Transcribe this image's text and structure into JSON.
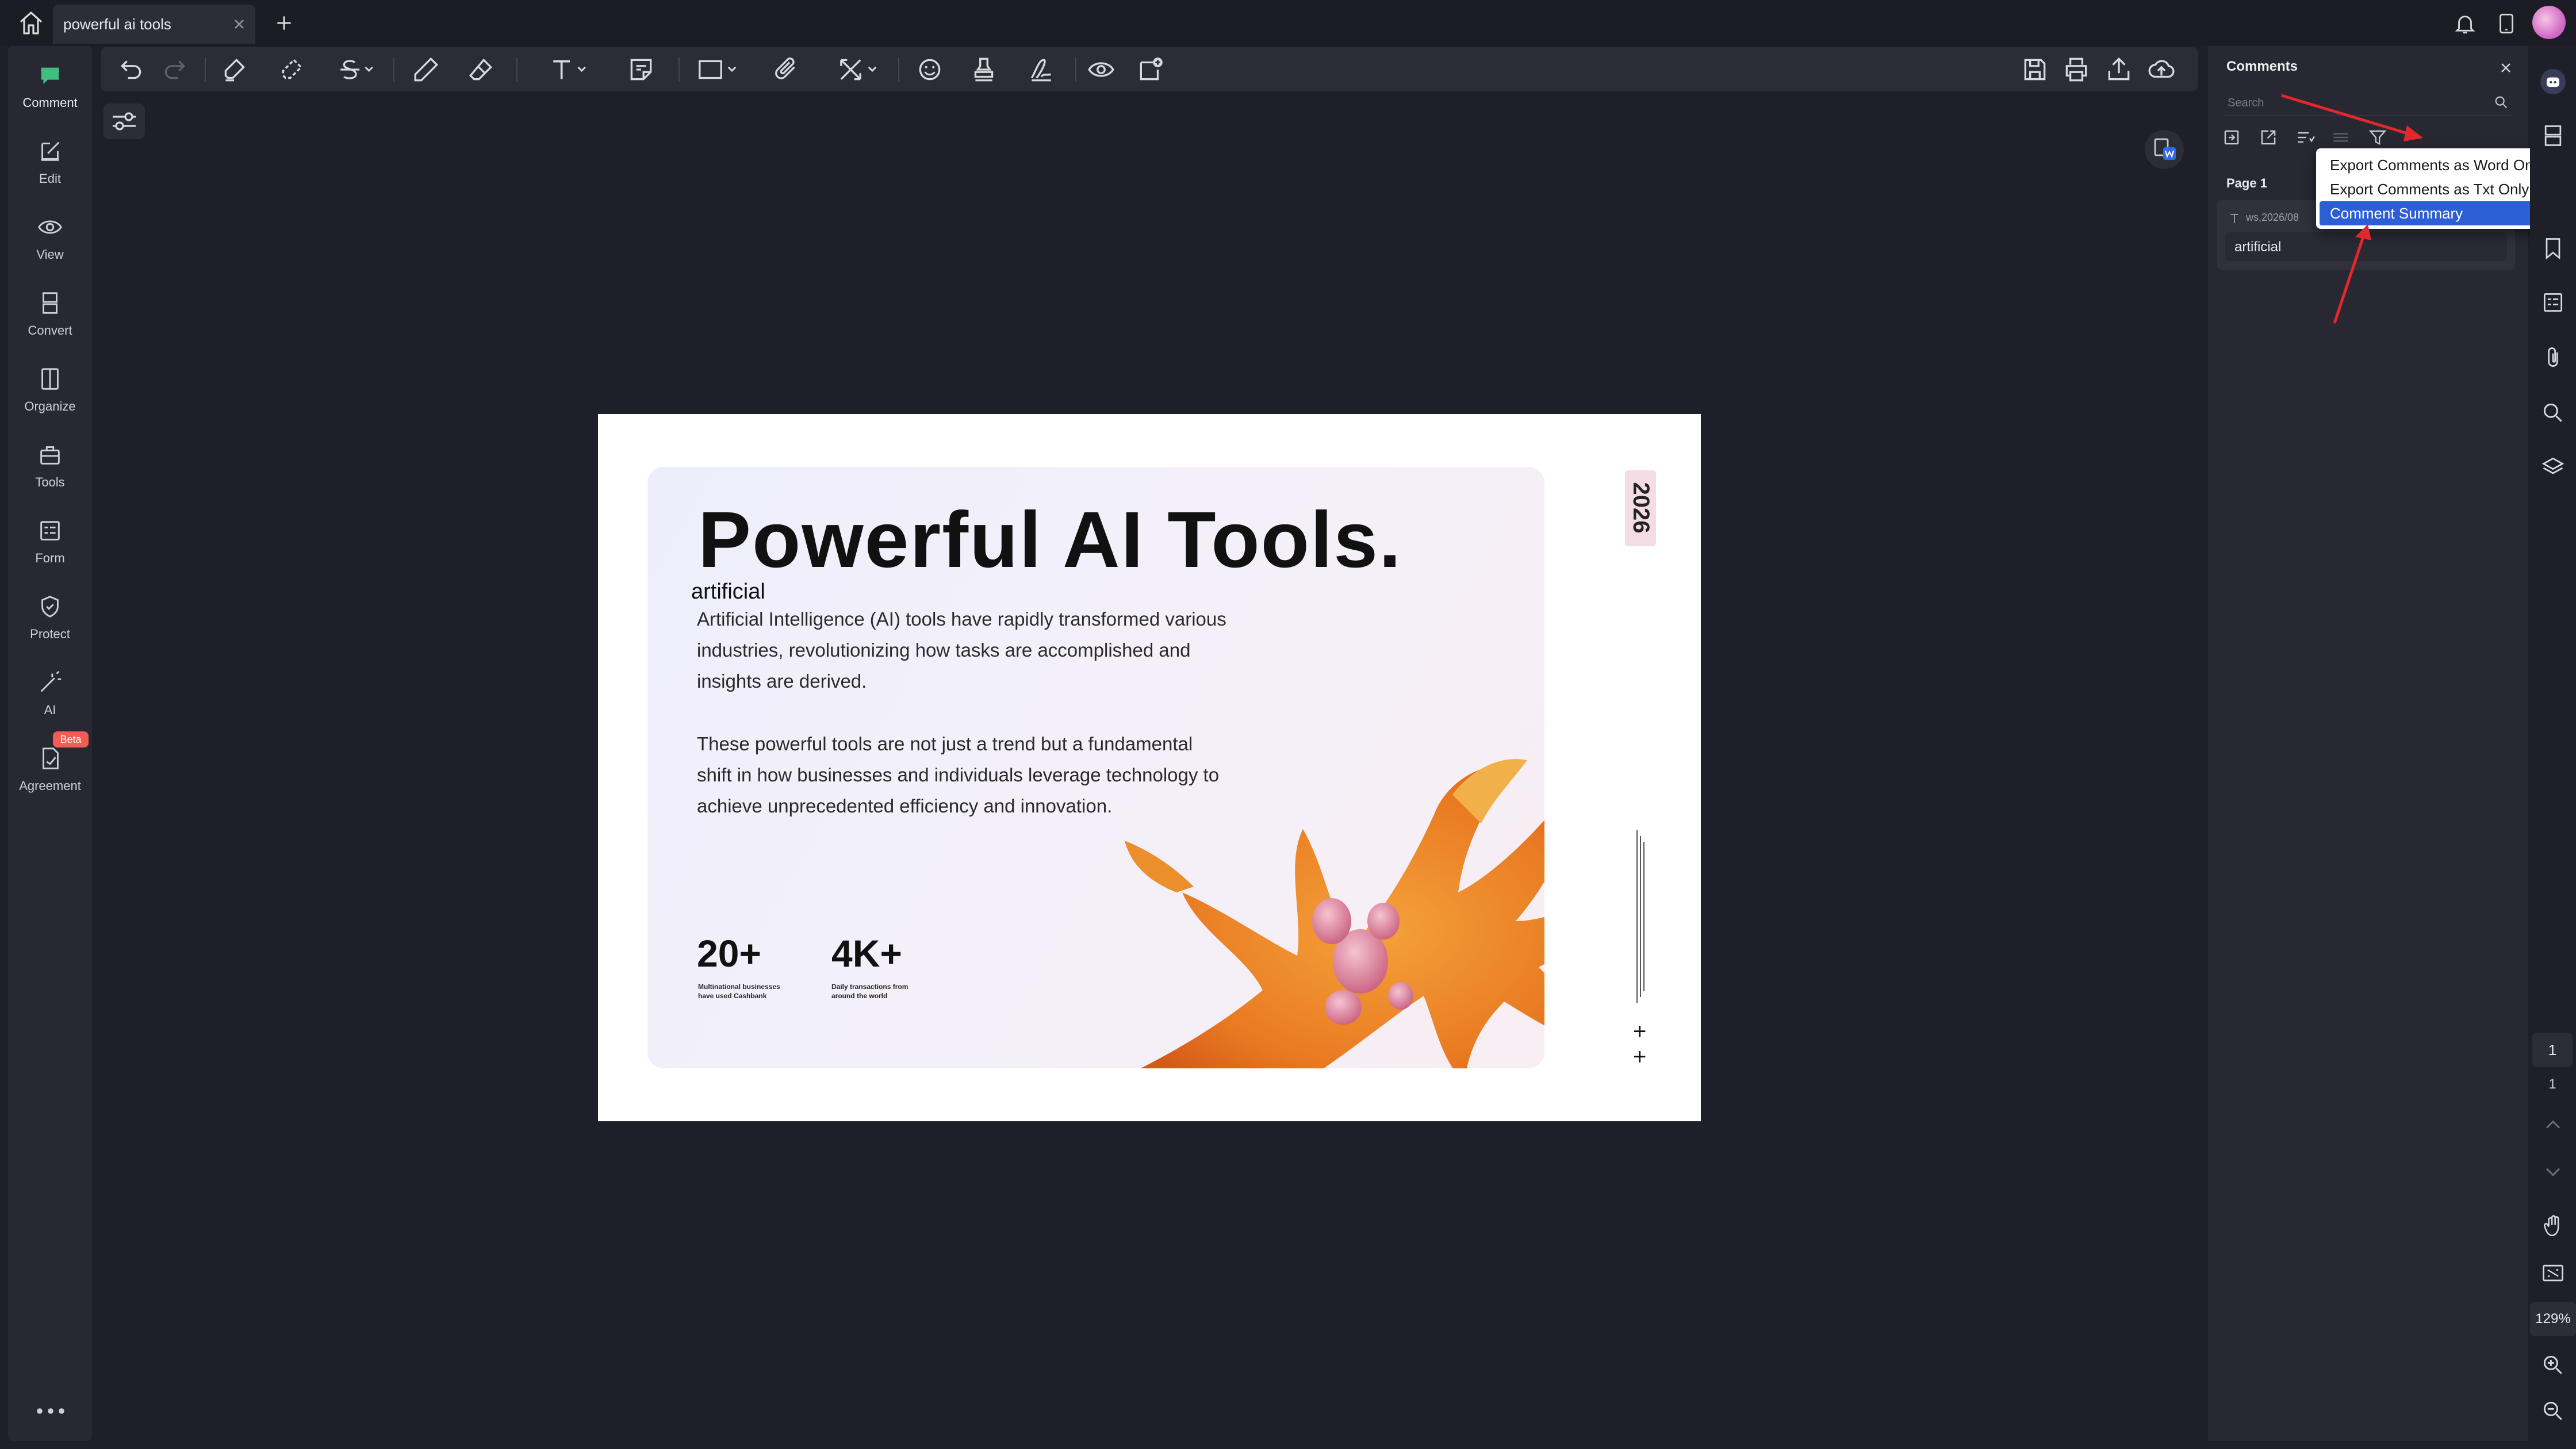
{
  "tab": {
    "title": "powerful ai tools"
  },
  "left_rail": {
    "items": [
      {
        "label": "Comment",
        "icon": "comment-icon"
      },
      {
        "label": "Edit",
        "icon": "edit-icon"
      },
      {
        "label": "View",
        "icon": "eye-icon"
      },
      {
        "label": "Convert",
        "icon": "convert-icon"
      },
      {
        "label": "Organize",
        "icon": "organize-icon"
      },
      {
        "label": "Tools",
        "icon": "toolbox-icon"
      },
      {
        "label": "Form",
        "icon": "form-icon"
      },
      {
        "label": "Protect",
        "icon": "shield-icon"
      },
      {
        "label": "AI",
        "icon": "magic-wand-icon"
      },
      {
        "label": "Agreement",
        "icon": "agreement-icon"
      }
    ],
    "beta_badge": "Beta"
  },
  "document": {
    "title": "Powerful AI Tools.",
    "annotation_text": "artificial",
    "paragraph1": "Artificial Intelligence (AI) tools have rapidly transformed various industries, revolutionizing how tasks are accomplished and insights are derived.",
    "paragraph2": "These powerful tools are not just a trend but a fundamental shift in how businesses and individuals leverage technology to achieve unprecedented efficiency and innovation.",
    "stat1": {
      "value": "20+",
      "line1": "Multinational businesses",
      "line2": "have used Cashbank"
    },
    "stat2": {
      "value": "4K+",
      "line1": "Daily transactions from",
      "line2": "around the world"
    },
    "year": "2026",
    "plus": "+"
  },
  "comments_panel": {
    "title": "Comments",
    "search_placeholder": "Search",
    "page_label": "Page 1",
    "comment": {
      "meta": "ws,2026/08",
      "text": "artificial"
    }
  },
  "export_menu": {
    "items": [
      "Export Comments as Word Only",
      "Export Comments as Txt Only",
      "Comment Summary"
    ],
    "selected_index": 2
  },
  "navigation": {
    "page_current": "1",
    "page_total": "1",
    "zoom": "129%"
  },
  "colors": {
    "accent": "#2c5fd5",
    "annotation_arrow": "#e0282e",
    "beta": "#f25c54"
  }
}
